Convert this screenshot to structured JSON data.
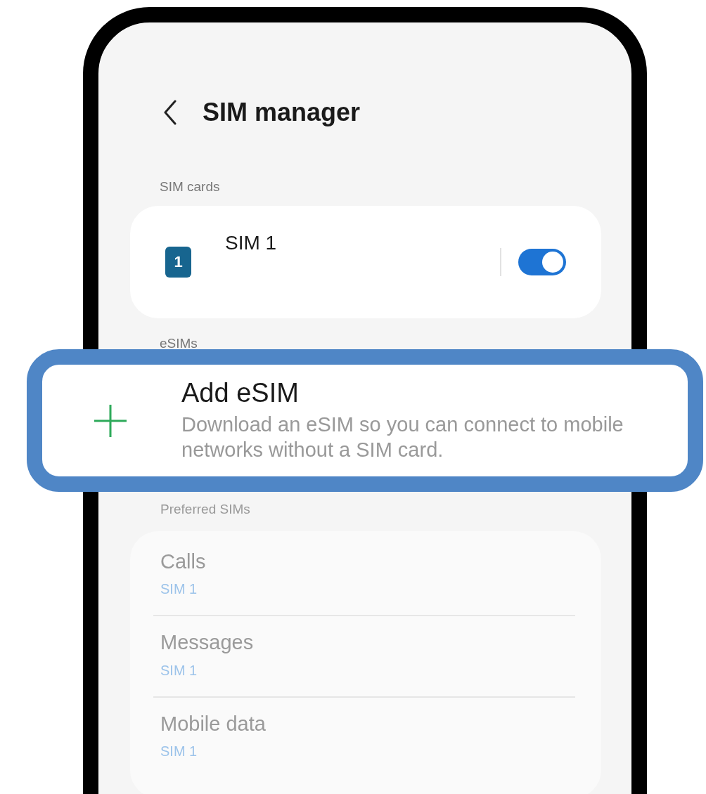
{
  "header": {
    "title": "SIM manager"
  },
  "sim_cards": {
    "label": "SIM cards",
    "items": [
      {
        "name": "SIM 1",
        "badge": "1",
        "on": true
      }
    ]
  },
  "esims": {
    "label": "eSIMs",
    "add": {
      "title": "Add eSIM",
      "description": "Download an eSIM so you can connect to mobile networks without a SIM card."
    }
  },
  "preferred_sims": {
    "label": "Preferred SIMs",
    "items": [
      {
        "title": "Calls",
        "value": "SIM 1"
      },
      {
        "title": "Messages",
        "value": "SIM 1"
      },
      {
        "title": "Mobile data",
        "value": "SIM 1"
      }
    ]
  }
}
